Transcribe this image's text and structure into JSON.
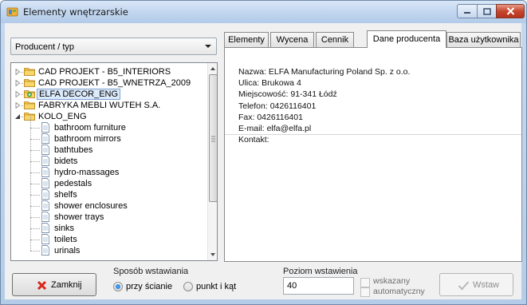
{
  "window": {
    "title": "Elementy wnętrzarskie"
  },
  "filter": {
    "selected": "Producent / typ"
  },
  "tree": {
    "nodes": [
      {
        "label": "CAD PROJEKT - B5_INTERIORS",
        "level": 0,
        "expanded": false,
        "selected": false,
        "icon": "folder-icon"
      },
      {
        "label": "CAD PROJEKT - B5_WNETRZA_2009",
        "level": 0,
        "expanded": false,
        "selected": false,
        "icon": "folder-icon"
      },
      {
        "label": "ELFA DECOR_ENG",
        "level": 0,
        "expanded": false,
        "selected": true,
        "icon": "folder-icon"
      },
      {
        "label": "FABRYKA MEBLI WUTEH S.A.",
        "level": 0,
        "expanded": false,
        "selected": false,
        "icon": "folder-icon"
      },
      {
        "label": "KOLO_ENG",
        "level": 0,
        "expanded": true,
        "selected": false,
        "icon": "folder-icon"
      },
      {
        "label": "bathroom furniture",
        "level": 1,
        "icon": "document-icon"
      },
      {
        "label": "bathroom mirrors",
        "level": 1,
        "icon": "document-icon"
      },
      {
        "label": "bathtubes",
        "level": 1,
        "icon": "document-icon"
      },
      {
        "label": "bidets",
        "level": 1,
        "icon": "document-icon"
      },
      {
        "label": "hydro-massages",
        "level": 1,
        "icon": "document-icon"
      },
      {
        "label": "pedestals",
        "level": 1,
        "icon": "document-icon"
      },
      {
        "label": "shelfs",
        "level": 1,
        "icon": "document-icon"
      },
      {
        "label": "shower enclosures",
        "level": 1,
        "icon": "document-icon"
      },
      {
        "label": "shower trays",
        "level": 1,
        "icon": "document-icon"
      },
      {
        "label": "sinks",
        "level": 1,
        "icon": "document-icon"
      },
      {
        "label": "toilets",
        "level": 1,
        "icon": "document-icon"
      },
      {
        "label": "urinals",
        "level": 1,
        "icon": "document-icon"
      }
    ]
  },
  "tabs": [
    {
      "label": "Elementy",
      "active": false
    },
    {
      "label": "Wycena",
      "active": false
    },
    {
      "label": "Cennik",
      "active": false
    },
    {
      "label": "Dane producenta",
      "active": true
    },
    {
      "label": "Baza użytkownika",
      "active": false
    }
  ],
  "producer": {
    "name": "Nazwa: ELFA Manufacturing Poland Sp. z o.o.",
    "street": "Ulica: Brukowa 4",
    "city": "Miejscowość: 91-341 Łódź",
    "phone": "Telefon: 0426116401",
    "fax": "Fax: 0426116401",
    "email": "E-mail: elfa@elfa.pl",
    "contact": "Kontakt:"
  },
  "footer": {
    "close_label": "Zamknij",
    "insert_mode_caption": "Sposób wstawiania",
    "insert_mode_options": [
      {
        "label": "przy ścianie",
        "checked": true
      },
      {
        "label": "punkt i kąt",
        "checked": false
      }
    ],
    "level_caption": "Poziom wstawienia",
    "level_value": "40",
    "auto_line1": "wskazany",
    "auto_line2": "automatyczny",
    "insert_label": "Wstaw"
  },
  "colors": {
    "selection_bg": "#dcebfc",
    "selection_border": "#7da2ce",
    "close_x": "#d8281b",
    "window_close": "#c6462e"
  }
}
